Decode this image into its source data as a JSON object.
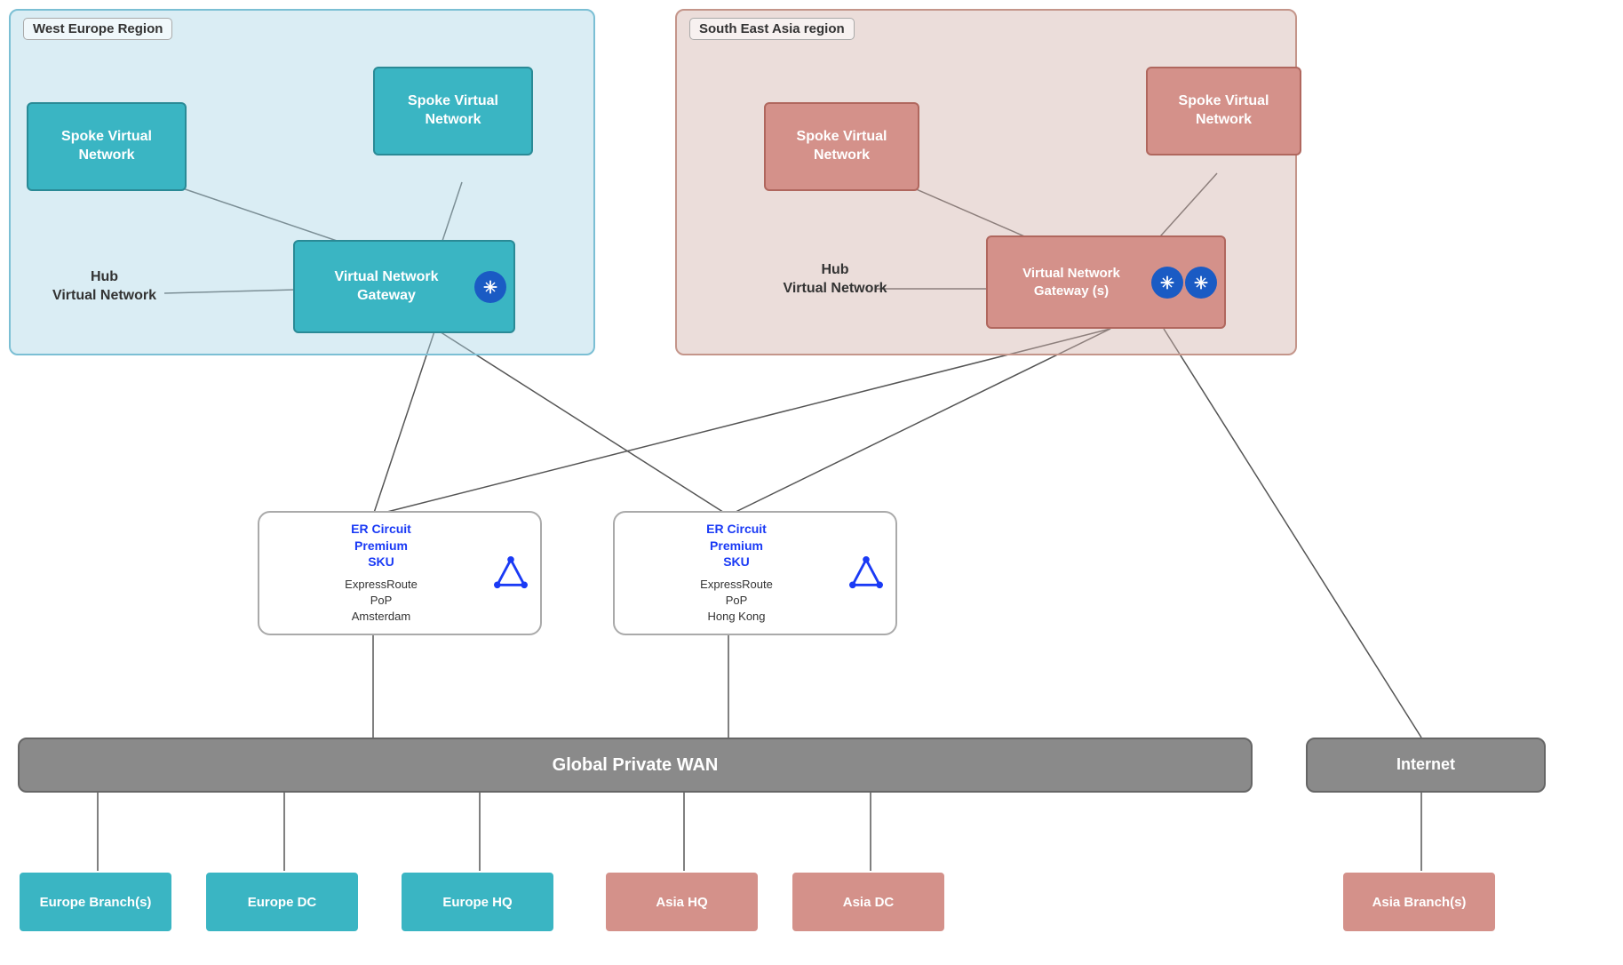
{
  "regions": {
    "west": {
      "label": "West Europe Region"
    },
    "sea": {
      "label": "South East Asia region"
    }
  },
  "west_europe": {
    "spoke1": "Spoke Virtual\nNetwork",
    "spoke2": "Spoke Virtual\nNetwork",
    "hub": "Hub\nVirtual Network",
    "gateway": "Virtual Network\nGateway"
  },
  "sea": {
    "spoke1": "Spoke Virtual\nNetwork",
    "spoke2": "Spoke Virtual\nNetwork",
    "hub": "Hub\nVirtual Network",
    "gateway": "Virtual Network\nGateway (s)"
  },
  "er_amsterdam": {
    "circuit": "ER Circuit\nPremium\nSKU",
    "pop": "ExpressRoute\nPoP\nAmsterdam"
  },
  "er_hongkong": {
    "circuit": "ER Circuit\nPremium\nSKU",
    "pop": "ExpressRoute\nPoP\nHong Kong"
  },
  "wan": {
    "label": "Global Private WAN"
  },
  "internet": {
    "label": "Internet"
  },
  "branches": {
    "europe_branch": "Europe Branch(s)",
    "europe_dc": "Europe DC",
    "europe_hq": "Europe HQ",
    "asia_hq": "Asia HQ",
    "asia_dc": "Asia DC",
    "asia_branch": "Asia Branch(s)"
  }
}
